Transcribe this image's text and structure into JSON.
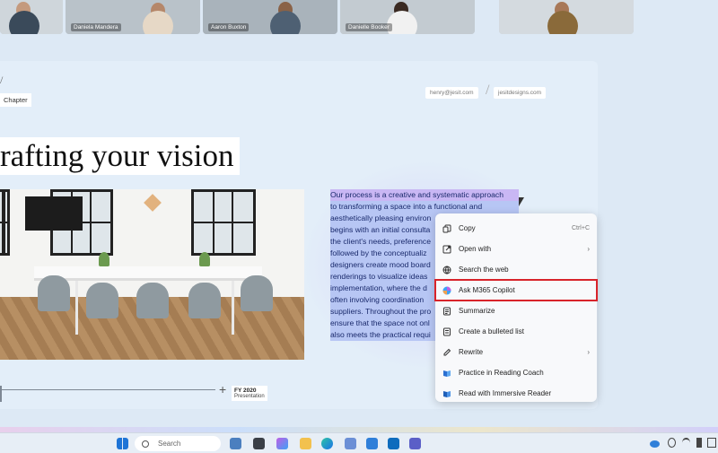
{
  "participants": [
    {
      "name": ""
    },
    {
      "name": "Daniela Mandera"
    },
    {
      "name": "Aaron Buxton"
    },
    {
      "name": "Danielle Booker"
    },
    {
      "name": ""
    }
  ],
  "slide": {
    "slash": "/",
    "chapter_label": "Chapter",
    "email": "henry@jesit.com",
    "website": "jesitdesigns.com",
    "pill_separator": "/",
    "title": "rafting your vision",
    "paragraph_lines": [
      "Our process is a creative and systematic approach",
      "to transforming a space into a functional and",
      "aesthetically pleasing environ",
      "begins with an initial consulta",
      "the client's needs, preference",
      "followed by the conceptualiz",
      "designers create mood board",
      "renderings to visualize ideas",
      "implementation, where the d",
      "often involving coordination",
      "suppliers. Throughout the pro",
      "ensure that the space not onl",
      "also meets the practical requi"
    ],
    "timeline": {
      "plus": "+",
      "year": "FY 2020",
      "subtitle": "Presentation"
    }
  },
  "context_menu": {
    "items": [
      {
        "label": "Copy",
        "icon": "copy-icon",
        "shortcut": "Ctrl+C",
        "chevron": ""
      },
      {
        "label": "Open with",
        "icon": "open-with-icon",
        "shortcut": "",
        "chevron": "›"
      },
      {
        "label": "Search the web",
        "icon": "globe-icon",
        "shortcut": "",
        "chevron": ""
      },
      {
        "label": "Ask M365 Copilot",
        "icon": "copilot-icon",
        "shortcut": "",
        "chevron": "",
        "highlighted": true
      },
      {
        "label": "Summarize",
        "icon": "summarize-icon",
        "shortcut": "",
        "chevron": ""
      },
      {
        "label": "Create a bulleted list",
        "icon": "bulleted-list-icon",
        "shortcut": "",
        "chevron": ""
      },
      {
        "label": "Rewrite",
        "icon": "rewrite-icon",
        "shortcut": "",
        "chevron": "›"
      },
      {
        "label": "Practice in Reading Coach",
        "icon": "reading-coach-icon",
        "shortcut": "",
        "chevron": ""
      },
      {
        "label": "Read with Immersive Reader",
        "icon": "immersive-reader-icon",
        "shortcut": "",
        "chevron": ""
      }
    ]
  },
  "taskbar": {
    "search_placeholder": "Search"
  },
  "colors": {
    "accent_highlight": "#d8232a",
    "selection": "#b7c6f4",
    "slide_bg": "#e3eef9"
  }
}
